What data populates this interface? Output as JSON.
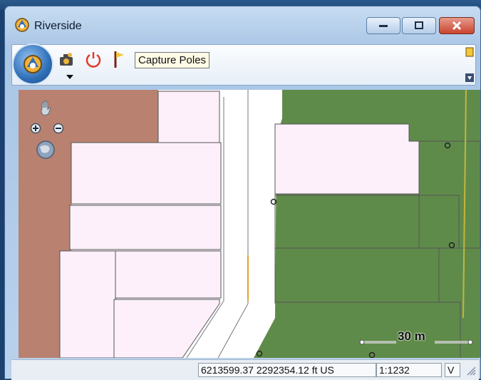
{
  "window": {
    "title": "Riverside",
    "buttons": {
      "minimize": "minimize-button",
      "restore": "restore-button",
      "close": "close-button"
    }
  },
  "toolbar": {
    "tools": [
      {
        "name": "camera-icon",
        "label": ""
      },
      {
        "name": "power-icon",
        "label": ""
      },
      {
        "name": "pole-flag-icon",
        "label": ""
      }
    ],
    "tooltip": "Capture Poles"
  },
  "map": {
    "scale_bar_label": "30 m",
    "colors": {
      "parcel": "#fdf0fb",
      "green": "#5f8b4a",
      "brown": "#b88170",
      "road": "#ffffff",
      "line": "#555555",
      "orange": "#e2a233",
      "yellow": "#c2b63e"
    },
    "nav_icons": [
      "pan-hand-icon",
      "zoom-in-icon",
      "zoom-out-icon",
      "globe-icon"
    ]
  },
  "status": {
    "coordinates": "6213599.37 2292354.12 ft US",
    "scale": "1:1232",
    "mode": "V"
  }
}
